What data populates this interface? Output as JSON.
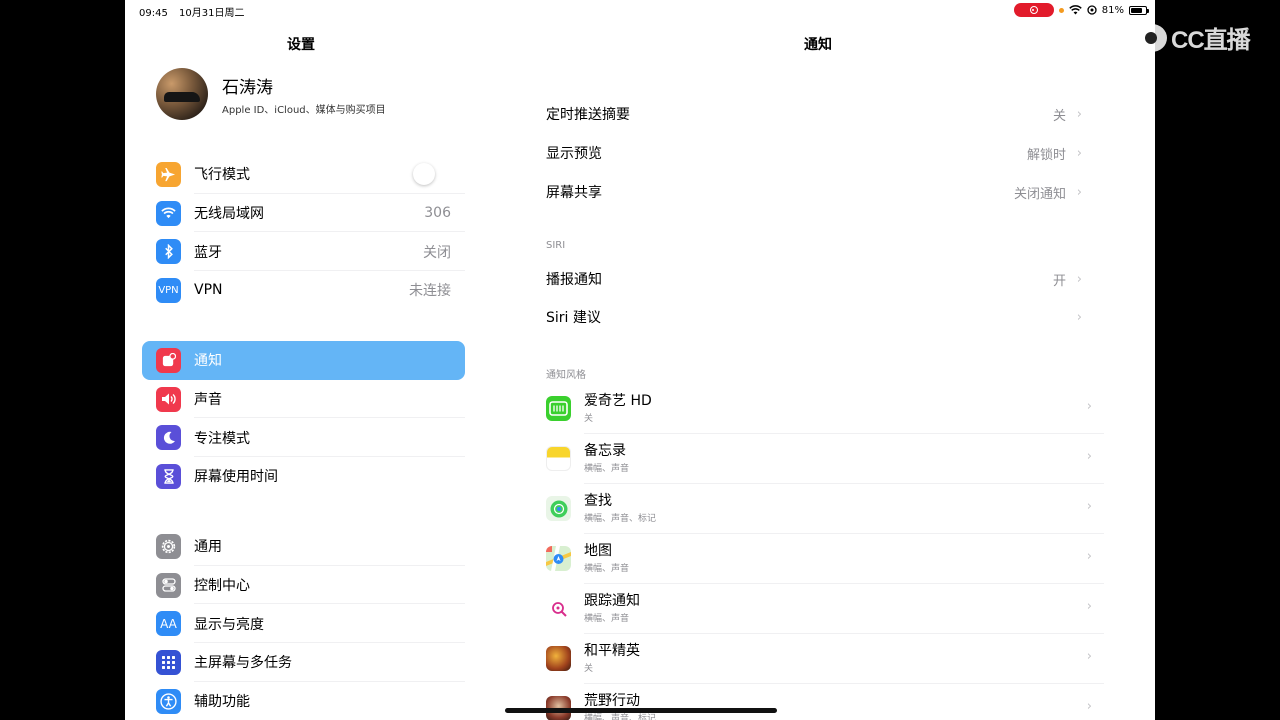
{
  "status_bar": {
    "time": "09:45",
    "date": "10月31日周二",
    "battery": "81%",
    "battery_level": 0.81,
    "record_color": "#e21b2b"
  },
  "watermark": {
    "text": "CC直播"
  },
  "sidebar": {
    "title": "设置",
    "profile": {
      "name": "石涛涛",
      "subtitle": "Apple ID、iCloud、媒体与购买项目"
    },
    "group1": [
      {
        "label": "飞行模式",
        "value": "",
        "icon": "airplane-icon",
        "color": "#f7a531",
        "toggle": false
      },
      {
        "label": "无线局域网",
        "value": "306",
        "icon": "wifi-icon",
        "color": "#2f8cf6"
      },
      {
        "label": "蓝牙",
        "value": "关闭",
        "icon": "bluetooth-icon",
        "color": "#2f8cf6"
      },
      {
        "label": "VPN",
        "value": "未连接",
        "icon": "vpn-icon",
        "icon_text": "VPN",
        "color": "#2f8cf6"
      }
    ],
    "group2": [
      {
        "label": "通知",
        "icon": "notification-icon",
        "color": "#f0394d",
        "selected": true
      },
      {
        "label": "声音",
        "icon": "speaker-icon",
        "color": "#f0394d"
      },
      {
        "label": "专注模式",
        "icon": "moon-icon",
        "color": "#5a4fd8"
      },
      {
        "label": "屏幕使用时间",
        "icon": "hourglass-icon",
        "color": "#5a4fd8"
      }
    ],
    "group3": [
      {
        "label": "通用",
        "icon": "gear-icon",
        "color": "#8e8e93"
      },
      {
        "label": "控制中心",
        "icon": "switches-icon",
        "color": "#8e8e93"
      },
      {
        "label": "显示与亮度",
        "icon": "display-icon",
        "icon_text": "AA",
        "color": "#2f8cf6"
      },
      {
        "label": "主屏幕与多任务",
        "icon": "grid-icon",
        "color": "#3552d4"
      },
      {
        "label": "辅助功能",
        "icon": "accessibility-icon",
        "color": "#2f8cf6"
      }
    ]
  },
  "detail": {
    "title": "通知",
    "rows1": [
      {
        "label": "定时推送摘要",
        "value": "关"
      },
      {
        "label": "显示预览",
        "value": "解锁时"
      },
      {
        "label": "屏幕共享",
        "value": "关闭通知"
      }
    ],
    "siri_header": "SIRI",
    "rows2": [
      {
        "label": "播报通知",
        "value": "开"
      },
      {
        "label": "Siri 建议",
        "value": ""
      }
    ],
    "style_header": "通知风格",
    "apps": [
      {
        "name": "爱奇艺 HD",
        "sub": "关",
        "icon": "iqiyi-icon"
      },
      {
        "name": "备忘录",
        "sub": "横幅、声音",
        "icon": "notes-icon"
      },
      {
        "name": "查找",
        "sub": "横幅、声音、标记",
        "icon": "findmy-icon"
      },
      {
        "name": "地图",
        "sub": "横幅、声音",
        "icon": "maps-icon"
      },
      {
        "name": "跟踪通知",
        "sub": "横幅、声音",
        "icon": "tracking-icon"
      },
      {
        "name": "和平精英",
        "sub": "关",
        "icon": "pubg-icon"
      },
      {
        "name": "荒野行动",
        "sub": "横幅、声音、标记",
        "icon": "knives-out-icon"
      }
    ]
  }
}
